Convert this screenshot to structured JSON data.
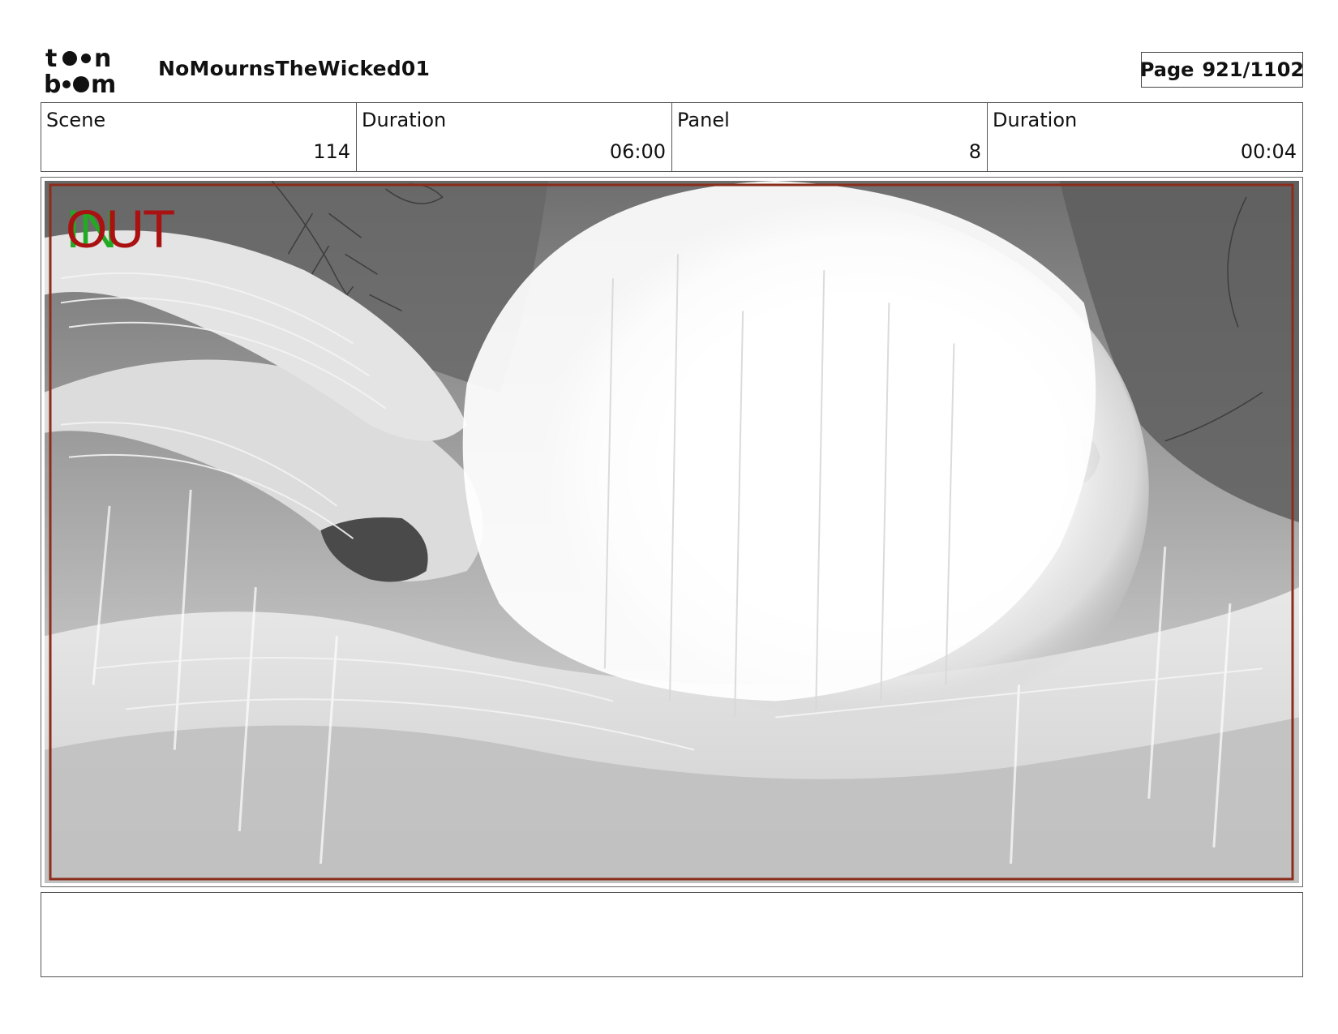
{
  "header": {
    "logo_text": "toon boom",
    "project_title": "NoMournsTheWicked01",
    "page_label": "Page",
    "page_number": "921/1102"
  },
  "info": {
    "scene_label": "Scene",
    "scene_value": "114",
    "scene_duration_label": "Duration",
    "scene_duration_value": "06:00",
    "panel_label": "Panel",
    "panel_value": "8",
    "panel_duration_label": "Duration",
    "panel_duration_value": "00:04"
  },
  "panel": {
    "overlay_in": "IN",
    "overlay_out": "OUT",
    "in_color": "#22aa22",
    "out_color": "#aa1111",
    "frame_color": "#8b2d1c"
  },
  "notes": {
    "text": ""
  }
}
